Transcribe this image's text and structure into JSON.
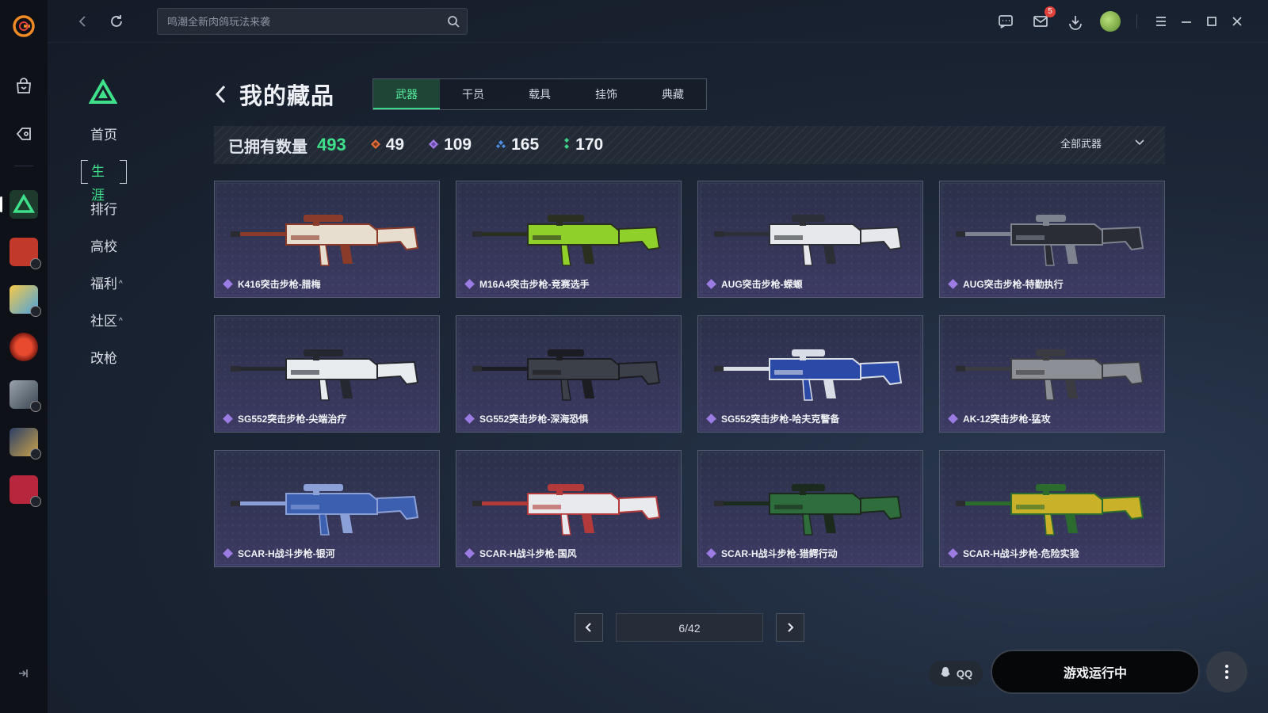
{
  "topbar": {
    "search_placeholder": "鸣潮全新肉鸽玩法来袭",
    "mail_badge": "5"
  },
  "nav": {
    "items": [
      {
        "label": "首页"
      },
      {
        "label": "生涯",
        "active": true
      },
      {
        "label": "排行"
      },
      {
        "label": "高校"
      },
      {
        "label": "福利",
        "caret": "^"
      },
      {
        "label": "社区",
        "caret": "^"
      },
      {
        "label": "改枪"
      }
    ]
  },
  "header": {
    "title": "我的藏品",
    "tabs": [
      "武器",
      "干员",
      "载具",
      "挂饰",
      "典藏"
    ],
    "active_tab": "武器"
  },
  "stats": {
    "owned_label": "已拥有数量",
    "owned_count": "493",
    "rarity_counts": [
      {
        "value": "49",
        "color": "#e0703a",
        "icon": "orange-diamond-icon"
      },
      {
        "value": "109",
        "color": "#a07be6",
        "icon": "purple-diamond-icon"
      },
      {
        "value": "165",
        "color": "#4f8fe6",
        "icon": "blue-diamond-icon"
      },
      {
        "value": "170",
        "color": "#3fd68a",
        "icon": "green-diamond-icon"
      }
    ],
    "filter_label": "全部武器"
  },
  "items": [
    {
      "name": "K416突击步枪-腊梅",
      "colors": [
        "#e8ded0",
        "#8a3b2a"
      ]
    },
    {
      "name": "M16A4突击步枪-竞赛选手",
      "colors": [
        "#8fd12a",
        "#2a2f20"
      ]
    },
    {
      "name": "AUG突击步枪-蝾螈",
      "colors": [
        "#e6e8ec",
        "#2c2f35"
      ]
    },
    {
      "name": "AUG突击步枪-特勤执行",
      "colors": [
        "#2a2d33",
        "#7d8490"
      ]
    },
    {
      "name": "SG552突击步枪-尖端治疗",
      "colors": [
        "#e9ecef",
        "#25282e"
      ]
    },
    {
      "name": "SG552突击步枪-深海恐惧",
      "colors": [
        "#3c4048",
        "#1b1d22"
      ]
    },
    {
      "name": "SG552突击步枪-哈夫克警备",
      "colors": [
        "#2b4aa8",
        "#d9dde6"
      ]
    },
    {
      "name": "AK-12突击步枪-猛攻",
      "colors": [
        "#8c8f96",
        "#3a3c41"
      ]
    },
    {
      "name": "SCAR-H战斗步枪-银河",
      "colors": [
        "#3c5fb0",
        "#8aa0d6"
      ]
    },
    {
      "name": "SCAR-H战斗步枪-国风",
      "colors": [
        "#e8eaee",
        "#b23a3a"
      ]
    },
    {
      "name": "SCAR-H战斗步枪-猎鳄行动",
      "colors": [
        "#2f6e3c",
        "#1c2a1e"
      ]
    },
    {
      "name": "SCAR-H战斗步枪-危险实验",
      "colors": [
        "#c9b22a",
        "#2c6b2e"
      ]
    }
  ],
  "pager": {
    "text": "6/42"
  },
  "bottom": {
    "qq_label": "QQ",
    "run_label": "游戏运行中"
  }
}
